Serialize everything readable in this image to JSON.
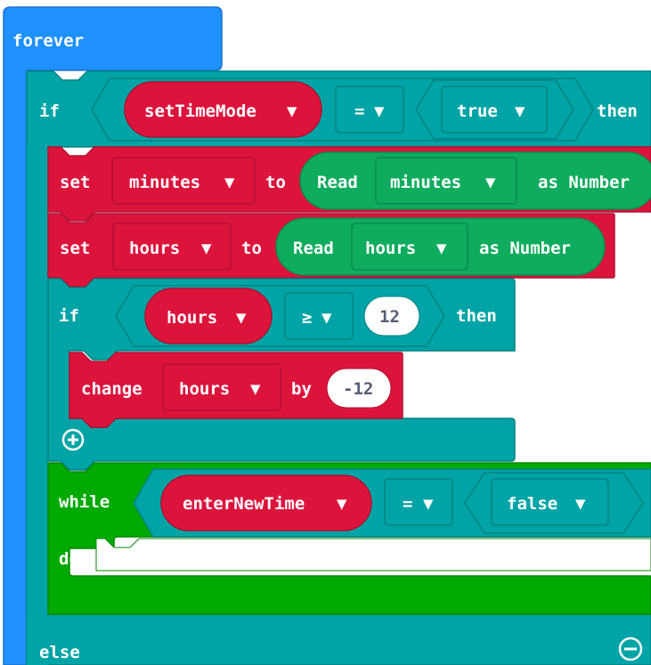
{
  "colors": {
    "basic": "#1e90ff",
    "logic": "#00a4a6",
    "logic_dark": "#008183",
    "variables": "#dc143c",
    "variables_dark": "#b10f30",
    "functions": "#0fac5e",
    "functions_dark": "#0a8a4a",
    "loops": "#00aa00",
    "loops_dark": "#008800",
    "logic_inner": "#0aa6a8"
  },
  "forever_block": {
    "label": "forever"
  },
  "if_outer": {
    "if_label": "if",
    "variable": "setTimeMode",
    "operator": "=",
    "value": "true",
    "then_label": "then",
    "else_label": "else",
    "remove_icon": "minus-circle-icon"
  },
  "set_minutes": {
    "set_label": "set",
    "variable": "minutes",
    "to_label": "to",
    "read_label": "Read",
    "read_variable": "minutes",
    "as_number_label": "as Number"
  },
  "set_hours": {
    "set_label": "set",
    "variable": "hours",
    "to_label": "to",
    "read_label": "Read",
    "read_variable": "hours",
    "as_number_label": "as Number"
  },
  "if_inner": {
    "if_label": "if",
    "variable": "hours",
    "operator": "≥",
    "value": "12",
    "then_label": "then",
    "add_icon": "plus-circle-icon"
  },
  "change_hours": {
    "change_label": "change",
    "variable": "hours",
    "by_label": "by",
    "value": "-12"
  },
  "while_block": {
    "while_label": "while",
    "variable": "enterNewTime",
    "operator": "=",
    "value": "false",
    "do_label": "do"
  },
  "dropdown_glyph": "▼"
}
